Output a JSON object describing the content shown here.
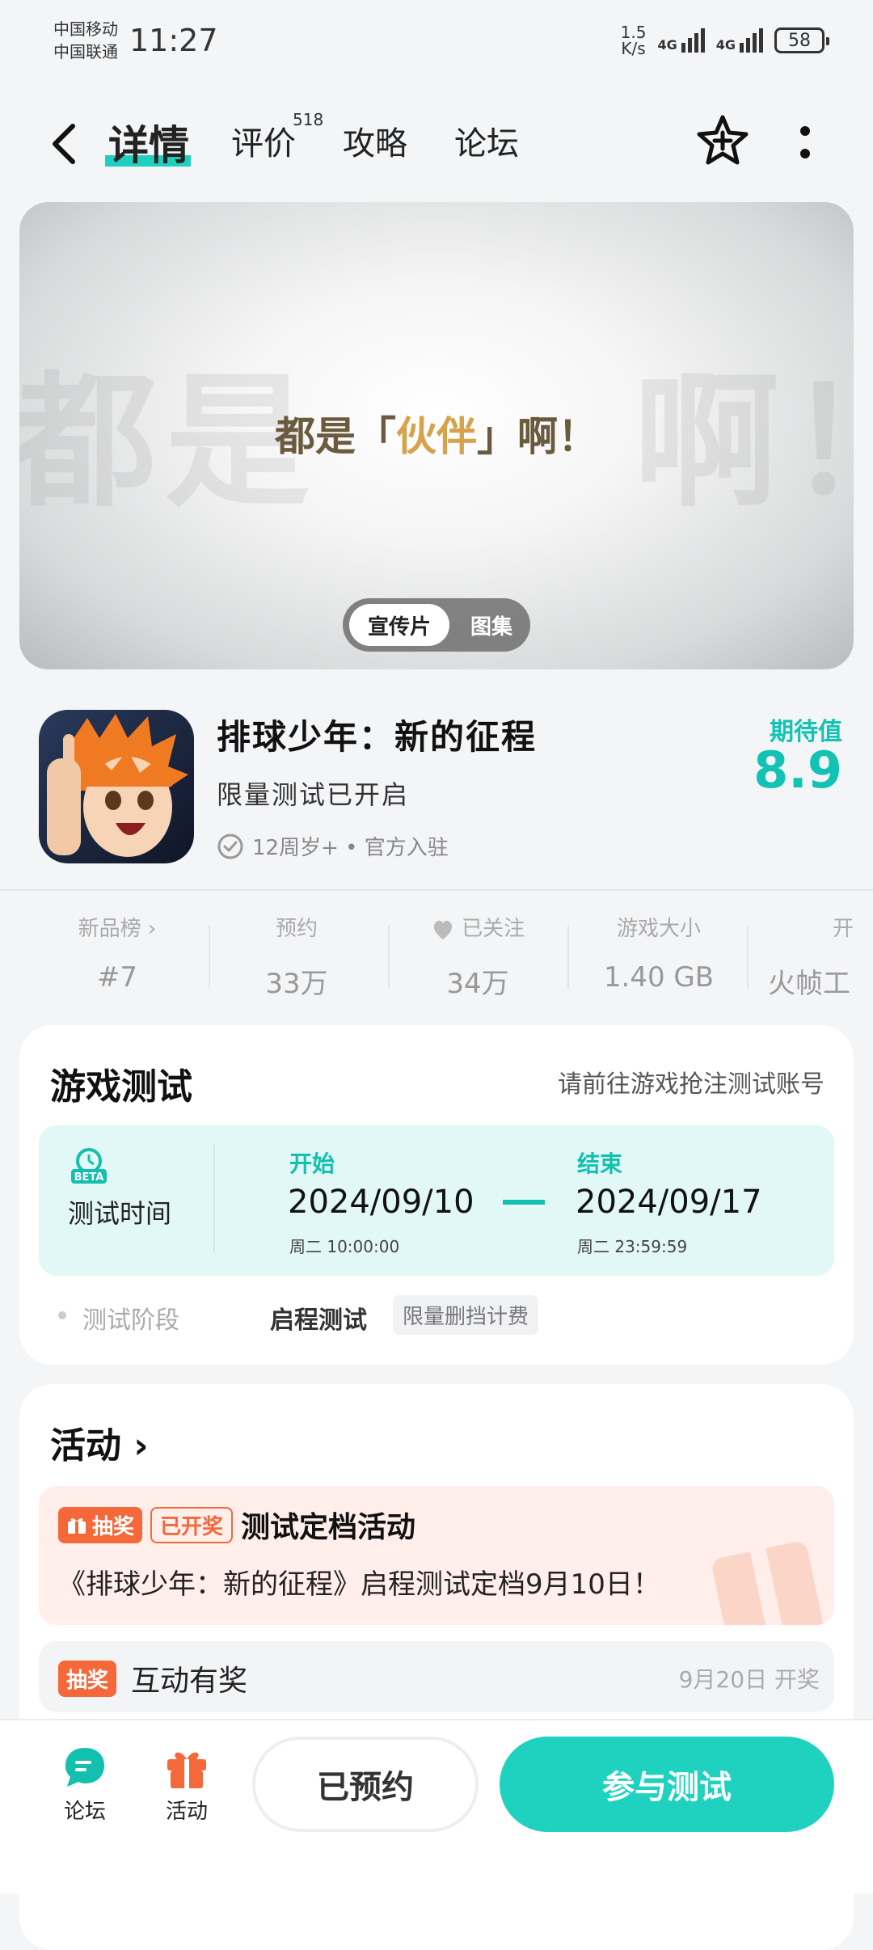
{
  "status": {
    "carrier1": "中国移动",
    "carrier2": "中国联通",
    "time": "11:27",
    "speed_value": "1.5",
    "speed_unit": "K/s",
    "net1": "4G",
    "net2": "4G",
    "battery": "58"
  },
  "header": {
    "tabs": [
      "详情",
      "评价",
      "攻略",
      "论坛"
    ],
    "review_count": "518"
  },
  "banner": {
    "slogan_pre": "都是「",
    "slogan_hl": "伙伴",
    "slogan_post": "」啊！",
    "ghost_left": "都是",
    "ghost_right": "啊！",
    "seg_active": "宣传片",
    "seg_other": "图集"
  },
  "game": {
    "title": "排球少年：新的征程",
    "subtitle": "限量测试已开启",
    "meta": "12周岁+ • 官方入驻",
    "expect_label": "期待值",
    "expect_value": "8.9"
  },
  "stats": [
    {
      "label": "新品榜",
      "value": "#7"
    },
    {
      "label": "预约",
      "value": "33万"
    },
    {
      "label": "已关注",
      "value": "34万"
    },
    {
      "label": "游戏大小",
      "value": "1.40 GB"
    },
    {
      "label": "开",
      "value": "火帧工"
    }
  ],
  "test": {
    "title": "游戏测试",
    "hint": "请前往游戏抢注测试账号",
    "beta_badge": "BETA",
    "time_label": "测试时间",
    "start_label": "开始",
    "start_date": "2024/09/10",
    "start_week": "周二  10:00:00",
    "end_label": "结束",
    "end_date": "2024/09/17",
    "end_week": "周二  23:59:59",
    "phase_label": "测试阶段",
    "phase_value": "启程测试",
    "phase_chip": "限量删挡计费"
  },
  "activity": {
    "title": "活动",
    "item1": {
      "tag": "抽奖",
      "status": "已开奖",
      "title": "测试定档活动",
      "desc": "《排球少年：新的征程》启程测试定档9月10日！"
    },
    "item2": {
      "tag": "抽奖",
      "title": "互动有奖",
      "date": "9月20日 开奖"
    }
  },
  "bottom": {
    "forum": "论坛",
    "activity": "活动",
    "reserved": "已预约",
    "join": "参与测试"
  },
  "colors": {
    "accent": "#1fd1bf",
    "orange": "#f4683a"
  }
}
